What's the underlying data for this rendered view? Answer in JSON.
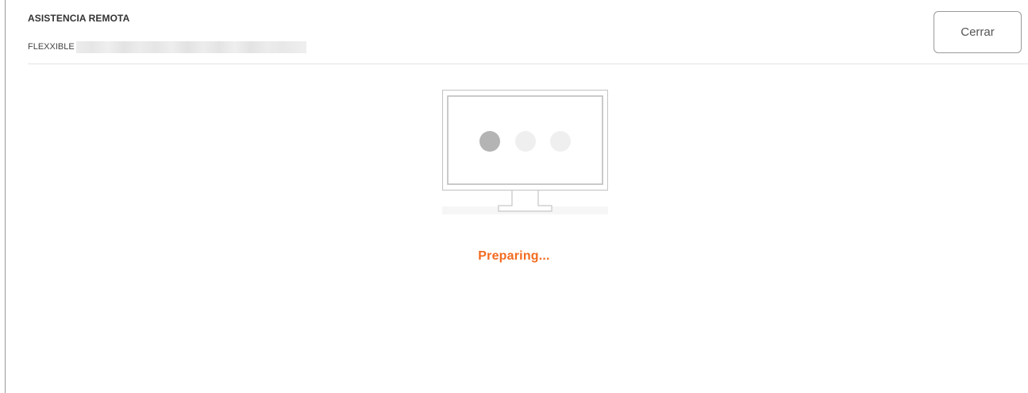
{
  "header": {
    "title": "ASISTENCIA REMOTA",
    "device_name": "FLEXXIBLE",
    "close_label": "Cerrar"
  },
  "status": {
    "text": "Preparing...",
    "color": "#f26b21"
  },
  "loader": {
    "active_dot_color": "#b4b4b4",
    "inactive_dot_color": "#efefef",
    "active_dot_index": 0
  },
  "icons": {
    "monitor": "monitor-icon"
  }
}
